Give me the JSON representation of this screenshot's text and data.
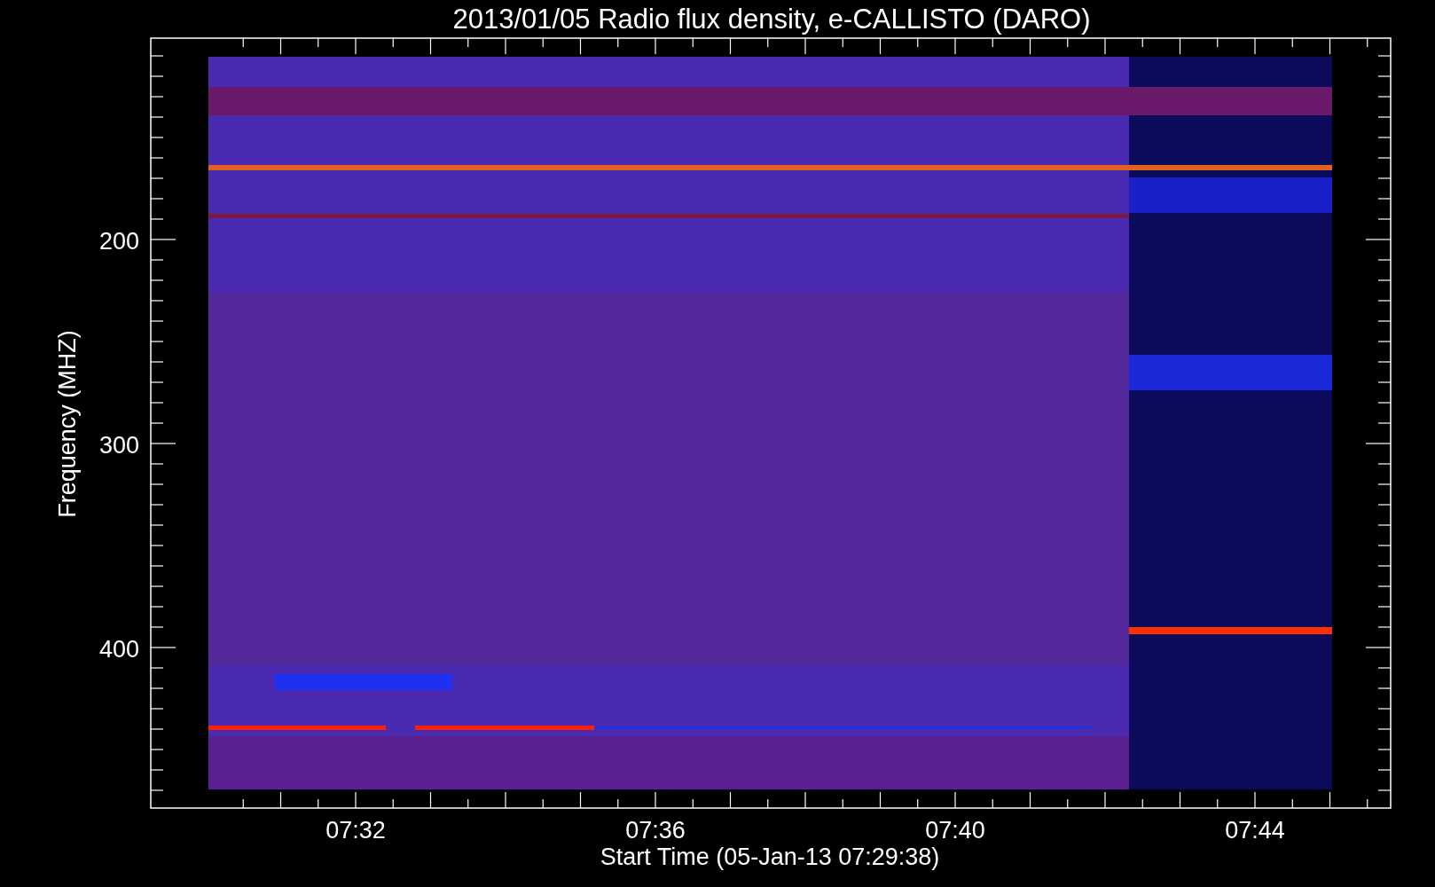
{
  "title": "2013/01/05  Radio flux density, e-CALLISTO (DARO)",
  "y_axis": {
    "label": "Frequency (MHZ)",
    "ticks": [
      "200",
      "300",
      "400"
    ]
  },
  "x_axis": {
    "label": "Start Time (05-Jan-13 07:29:38)",
    "ticks": [
      "07:32",
      "07:36",
      "07:40",
      "07:44"
    ]
  }
}
